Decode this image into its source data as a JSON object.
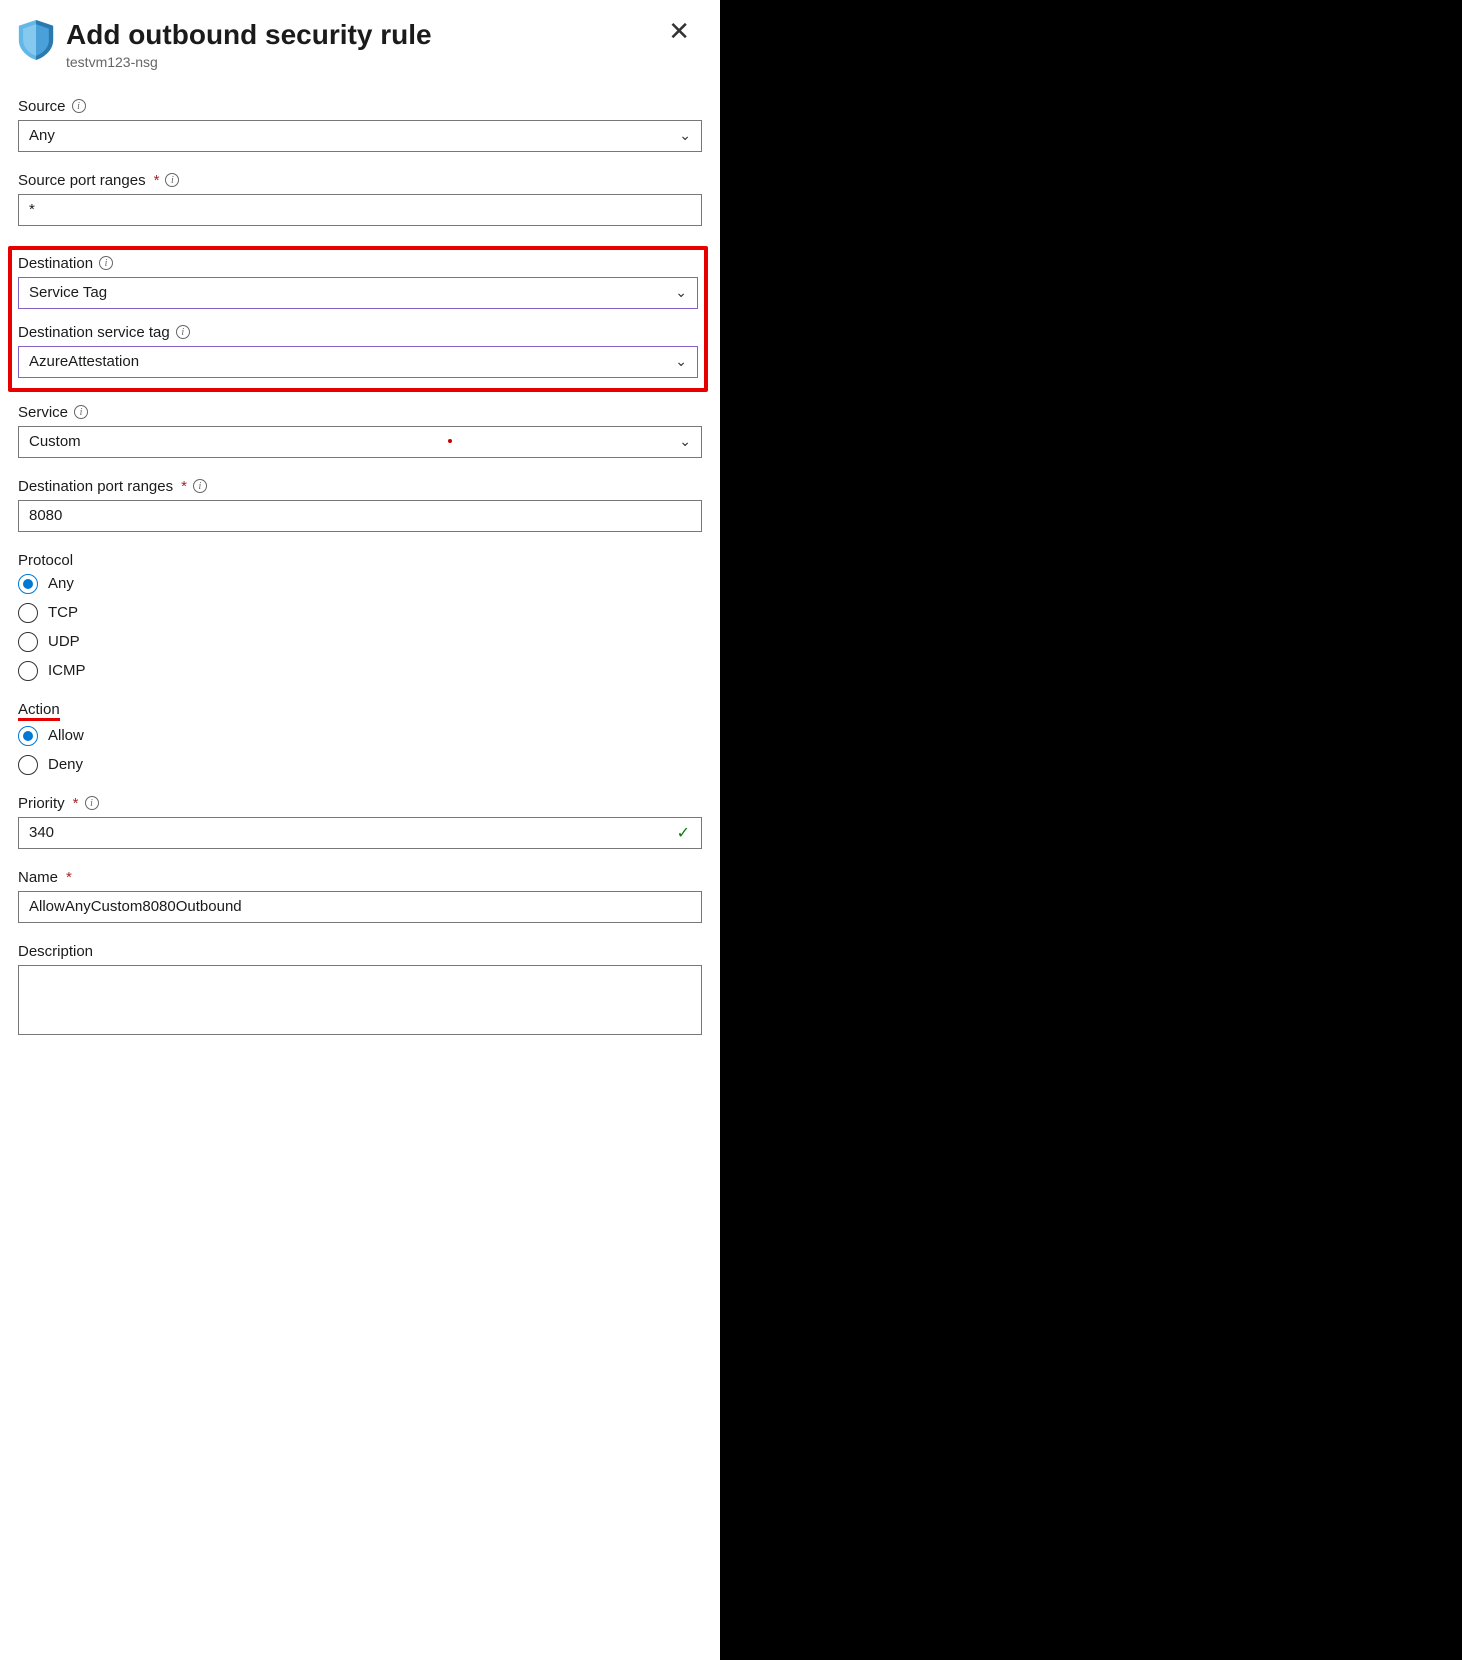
{
  "header": {
    "title": "Add outbound security rule",
    "subtitle": "testvm123-nsg"
  },
  "fields": {
    "source": {
      "label": "Source",
      "value": "Any"
    },
    "sourcePortRanges": {
      "label": "Source port ranges",
      "value": "*"
    },
    "destination": {
      "label": "Destination",
      "value": "Service Tag"
    },
    "destinationServiceTag": {
      "label": "Destination service tag",
      "value": "AzureAttestation"
    },
    "service": {
      "label": "Service",
      "value": "Custom"
    },
    "destinationPortRanges": {
      "label": "Destination port ranges",
      "value": "8080"
    },
    "protocol": {
      "label": "Protocol",
      "options": [
        "Any",
        "TCP",
        "UDP",
        "ICMP"
      ],
      "selected": "Any"
    },
    "action": {
      "label": "Action",
      "options": [
        "Allow",
        "Deny"
      ],
      "selected": "Allow"
    },
    "priority": {
      "label": "Priority",
      "value": "340"
    },
    "name": {
      "label": "Name",
      "value": "AllowAnyCustom8080Outbound"
    },
    "description": {
      "label": "Description",
      "value": ""
    }
  }
}
